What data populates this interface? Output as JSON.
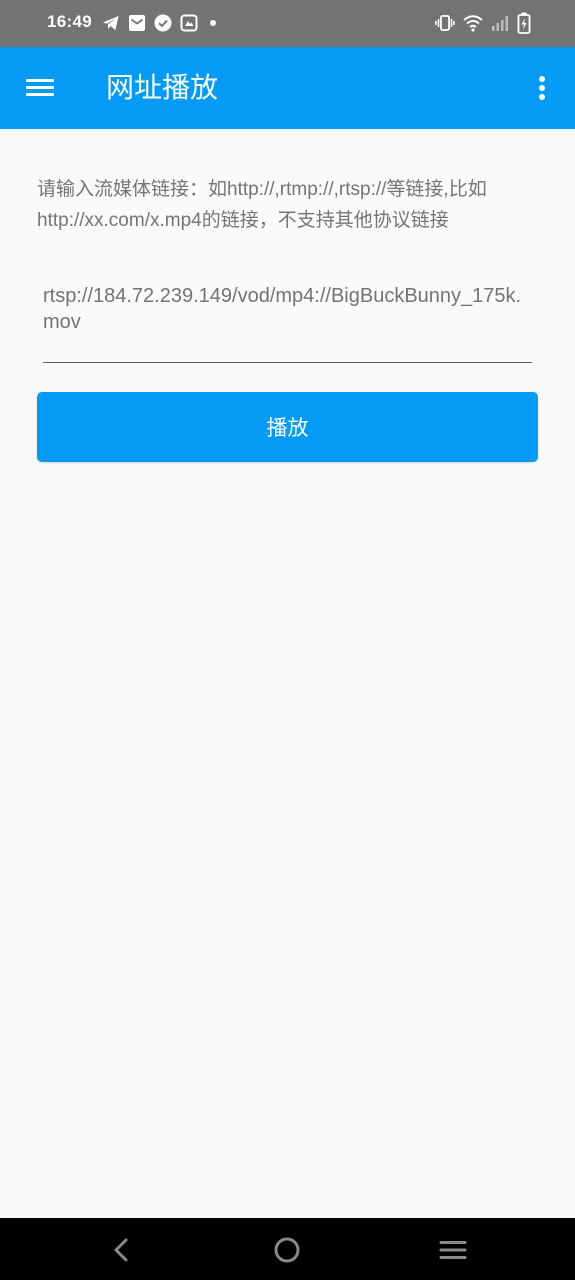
{
  "status_bar": {
    "time": "16:49",
    "left_icons": [
      "telegram-icon",
      "mail-icon",
      "check-circle-icon",
      "gallery-icon",
      "dot-icon"
    ],
    "right_icons": [
      "vibrate-icon",
      "wifi-icon",
      "signal-icon",
      "battery-charging-icon"
    ]
  },
  "app_bar": {
    "title": "网址播放",
    "color": "#039bf5"
  },
  "form": {
    "hint": "请输入流媒体链接：如http://,rtmp://,rtsp://等链接,比如http://xx.com/x.mp4的链接，不支持其他协议链接",
    "url_value": "rtsp://184.72.239.149/vod/mp4://BigBuckBunny_175k.mov",
    "play_label": "播放"
  },
  "nav_bar": {
    "buttons": [
      "back-icon",
      "home-icon",
      "recents-icon"
    ]
  }
}
